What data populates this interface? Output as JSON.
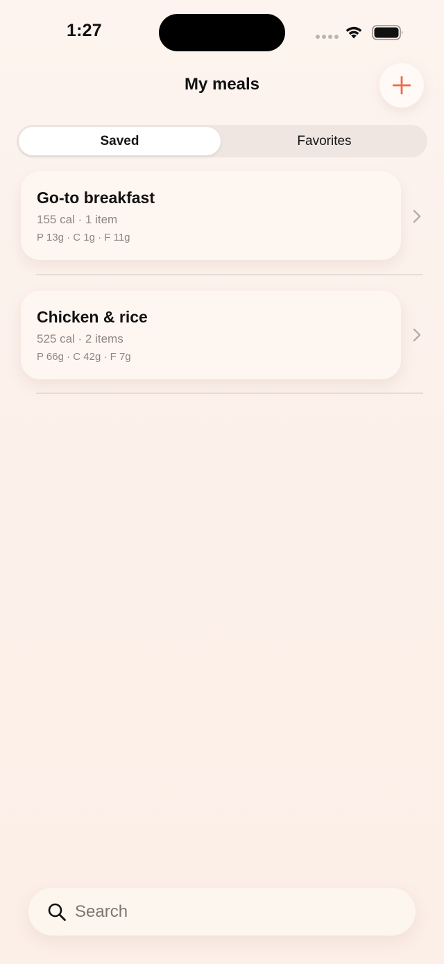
{
  "status_bar": {
    "time": "1:27"
  },
  "header": {
    "title": "My meals",
    "add_icon": "plus-icon"
  },
  "tabs": [
    {
      "label": "Saved",
      "selected": true
    },
    {
      "label": "Favorites",
      "selected": false
    }
  ],
  "meals": [
    {
      "name": "Go-to breakfast",
      "summary": "155 cal · 1 item",
      "macros": "P 13g · C 1g · F 11g"
    },
    {
      "name": "Chicken & rice",
      "summary": "525 cal · 2 items",
      "macros": "P 66g · C 42g · F 7g"
    }
  ],
  "search": {
    "placeholder": "Search",
    "value": ""
  },
  "colors": {
    "accent": "#ef6a4d",
    "background": "#fcf0ea"
  }
}
